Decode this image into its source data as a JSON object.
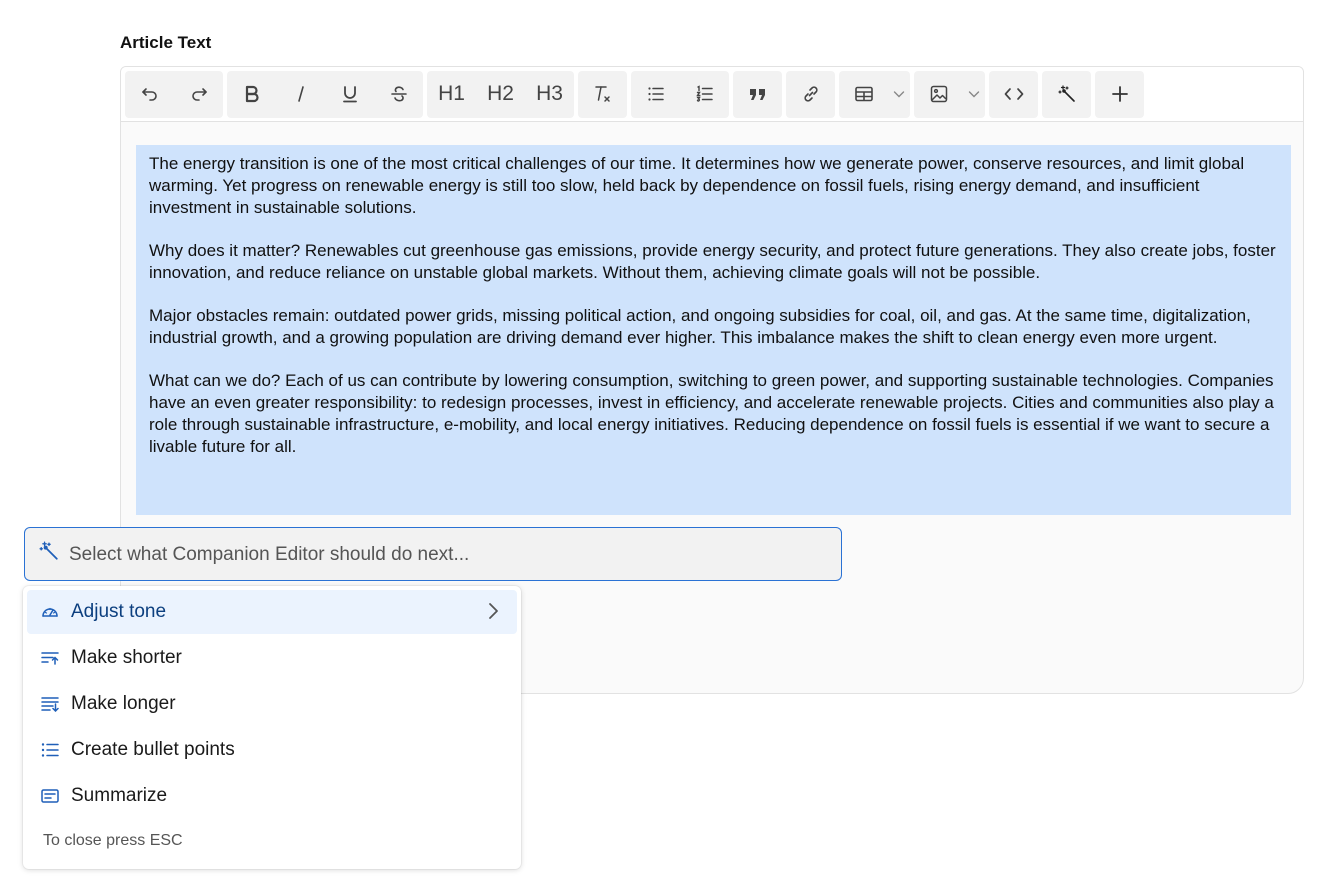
{
  "field": {
    "label": "Article Text"
  },
  "toolbar": {
    "groups": [
      [
        "undo-icon",
        "redo-icon"
      ],
      [
        "bold-icon",
        "italic-icon",
        "underline-icon",
        "strikethrough-icon"
      ],
      [
        "H1",
        "H2",
        "H3"
      ],
      [
        "clear-format-icon"
      ],
      [
        "bullet-list-icon",
        "numbered-list-icon"
      ],
      [
        "blockquote-icon"
      ],
      [
        "link-icon"
      ],
      [
        "table-icon",
        "chevron-down-icon"
      ],
      [
        "image-icon",
        "chevron-down-icon"
      ],
      [
        "code-icon"
      ],
      [
        "magic-wand-icon"
      ],
      [
        "plus-icon"
      ]
    ],
    "h1_label": "H1",
    "h2_label": "H2",
    "h3_label": "H3"
  },
  "content": {
    "paragraphs": [
      "The energy transition is one of the most critical challenges of our time. It determines how we generate power, conserve resources, and limit global warming. Yet progress on renewable energy is still too slow, held back by dependence on fossil fuels, rising energy demand, and insufficient investment in sustainable solutions.",
      "Why does it matter? Renewables cut greenhouse gas emissions, provide energy security, and protect future generations. They also create jobs, foster innovation, and reduce reliance on unstable global markets. Without them, achieving climate goals will not be possible.",
      "Major obstacles remain: outdated power grids, missing political action, and ongoing subsidies for coal, oil, and gas. At the same time, digitalization, industrial growth, and a growing population are driving demand ever higher. This imbalance makes the shift to clean energy even more urgent.",
      "What can we do? Each of us can contribute by lowering consumption, switching to green power, and supporting sustainable technologies. Companies have an even greater responsibility: to redesign processes, invest in efficiency, and accelerate renewable projects. Cities and communities also play a role through sustainable infrastructure, e-mobility, and local energy initiatives. Reducing dependence on fossil fuels is essential if we want to secure a livable future for all."
    ],
    "selection_color": "#cfe3fc"
  },
  "ai": {
    "placeholder": "Select what Companion Editor should do next...",
    "value": "",
    "accent": "#2a72d4"
  },
  "menu": {
    "items": [
      {
        "label": "Adjust tone",
        "icon": "gauge-icon",
        "active": true,
        "submenu": true
      },
      {
        "label": "Make shorter",
        "icon": "make-shorter-icon",
        "active": false
      },
      {
        "label": "Make longer",
        "icon": "make-longer-icon",
        "active": false
      },
      {
        "label": "Create bullet points",
        "icon": "bullet-list-icon",
        "active": false
      },
      {
        "label": "Summarize",
        "icon": "summary-icon",
        "active": false
      }
    ],
    "hint": "To close press ESC",
    "icon_color": "#1f5fb8"
  }
}
